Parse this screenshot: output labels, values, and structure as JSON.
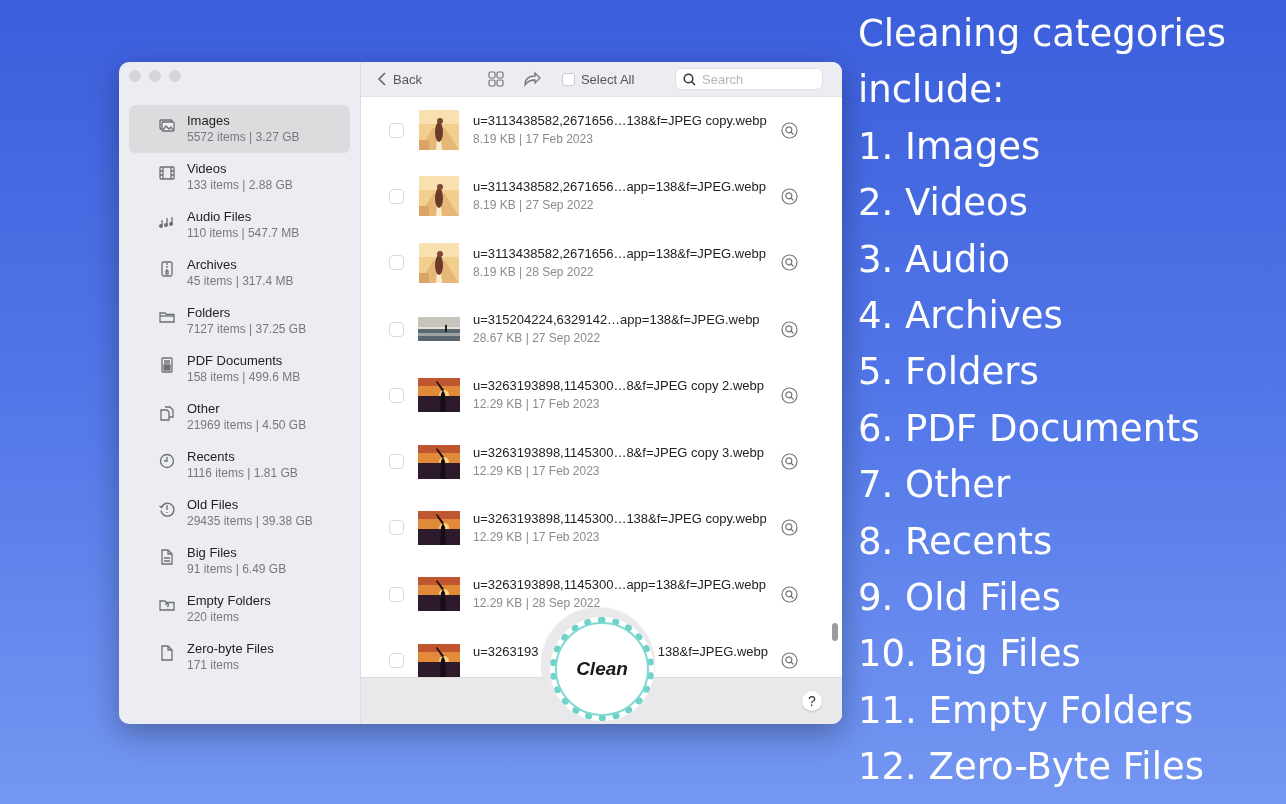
{
  "sidebar": {
    "items": [
      {
        "name": "Images",
        "meta": "5572 items | 3.27 GB",
        "selected": true
      },
      {
        "name": "Videos",
        "meta": "133 items | 2.88 GB",
        "selected": false
      },
      {
        "name": "Audio Files",
        "meta": "110 items | 547.7 MB",
        "selected": false
      },
      {
        "name": "Archives",
        "meta": "45 items | 317.4 MB",
        "selected": false
      },
      {
        "name": "Folders",
        "meta": "7127 items | 37.25 GB",
        "selected": false
      },
      {
        "name": "PDF Documents",
        "meta": "158 items | 499.6 MB",
        "selected": false
      },
      {
        "name": "Other",
        "meta": "21969 items | 4.50 GB",
        "selected": false
      },
      {
        "name": "Recents",
        "meta": "1116 items | 1.81 GB",
        "selected": false
      },
      {
        "name": "Old Files",
        "meta": "29435 items | 39.38 GB",
        "selected": false
      },
      {
        "name": "Big Files",
        "meta": "91 items | 6.49 GB",
        "selected": false
      },
      {
        "name": "Empty Folders",
        "meta": "220 items",
        "selected": false
      },
      {
        "name": "Zero-byte Files",
        "meta": "171 items",
        "selected": false
      }
    ]
  },
  "toolbar": {
    "back": "Back",
    "select_all": {
      "label": "Select All",
      "checked": false
    },
    "search": {
      "placeholder": "Search"
    }
  },
  "files": [
    {
      "kind": "file",
      "name": "u=3113438582,2671656…138&f=JPEG copy.webp",
      "meta": "8.19 KB | 17 Feb 2023",
      "checked": false
    },
    {
      "kind": "file",
      "name": "u=3113438582,2671656…app=138&f=JPEG.webp",
      "meta": "8.19 KB | 27 Sep 2022",
      "checked": false
    },
    {
      "kind": "file",
      "name": "u=3113438582,2671656…app=138&f=JPEG.webp",
      "meta": "8.19 KB | 28 Sep 2022",
      "checked": false
    },
    {
      "kind": "file",
      "name": "u=315204224,6329142…app=138&f=JPEG.webp",
      "meta": "28.67 KB | 27 Sep 2022",
      "checked": false
    },
    {
      "kind": "file",
      "name": "u=3263193898,1145300…8&f=JPEG copy 2.webp",
      "meta": "12.29 KB | 17 Feb 2023",
      "checked": false
    },
    {
      "kind": "file",
      "name": "u=3263193898,1145300…8&f=JPEG copy 3.webp",
      "meta": "12.29 KB | 17 Feb 2023",
      "checked": false
    },
    {
      "kind": "file",
      "name": "u=3263193898,1145300…138&f=JPEG copy.webp",
      "meta": "12.29 KB | 17 Feb 2023",
      "checked": false
    },
    {
      "kind": "file",
      "name": "u=3263193898,1145300…app=138&f=JPEG.webp",
      "meta": "12.29 KB | 28 Sep 2022",
      "checked": false
    },
    {
      "kind": "covered",
      "name_start": "u=3263193",
      "name_end": "138&f=JPEG.webp",
      "checked": false
    }
  ],
  "footer": {
    "clean": "Clean",
    "help": "?"
  },
  "caption": {
    "heading": "Cleaning categories include:",
    "items": [
      "1. Images",
      "2. Videos",
      "3. Audio",
      "4. Archives",
      "5. Folders",
      "6. PDF Documents",
      "7. Other",
      "8. Recents",
      "9. Old Files",
      "10. Big Files",
      "11. Empty Folders",
      "12. Zero-Byte Files"
    ]
  }
}
